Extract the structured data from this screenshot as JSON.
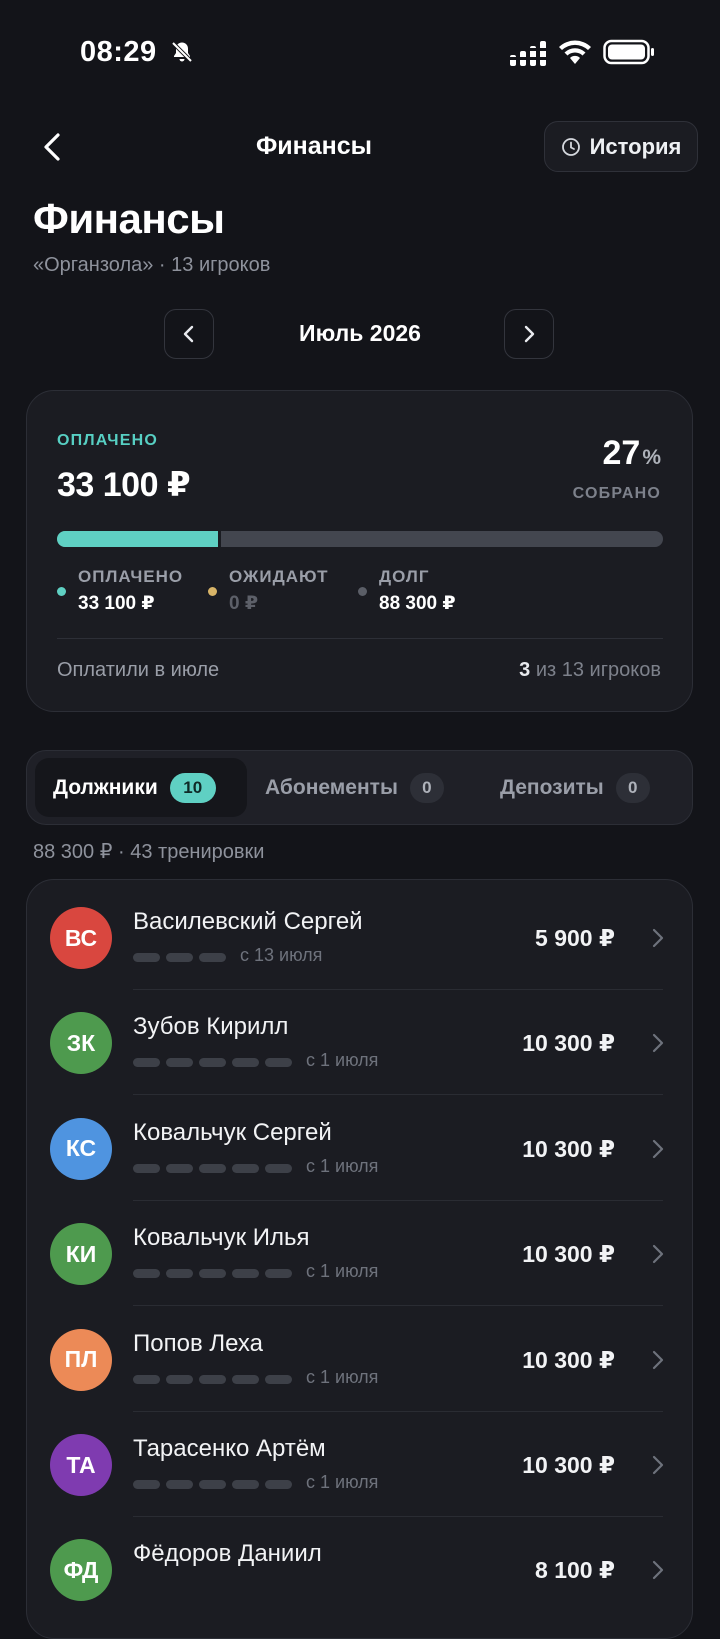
{
  "status_bar": {
    "time": "08:29"
  },
  "nav": {
    "title": "Финансы",
    "history_label": "История"
  },
  "header": {
    "title": "Финансы",
    "subtitle": "«Органзола» · 13 игроков"
  },
  "month": {
    "label": "Июль 2026"
  },
  "summary": {
    "paid_caption": "ОПЛАЧЕНО",
    "paid_amount": "33 100 ₽",
    "percent": "27",
    "percent_sign": "%",
    "collected_label": "СОБРАНО",
    "progress_fraction": 0.27,
    "legend": [
      {
        "label": "ОПЛАЧЕНО",
        "value": "33 100 ₽",
        "color": "#5fd0c3"
      },
      {
        "label": "ОЖИДАЮТ",
        "value": "0 ₽",
        "color": "#d8b468"
      },
      {
        "label": "ДОЛГ",
        "value": "88 300 ₽",
        "color": "#5b5e67"
      }
    ],
    "paid_in_month": "Оплатили в июле",
    "players_paid_count": "3",
    "players_paid_rest": " из 13 игроков"
  },
  "tabs": [
    {
      "label": "Должники",
      "count": "10",
      "active": true
    },
    {
      "label": "Абонементы",
      "count": "0",
      "active": false
    },
    {
      "label": "Депозиты",
      "count": "0",
      "active": false
    }
  ],
  "debt_summary": "88 300 ₽ · 43 тренировки",
  "debtors": [
    {
      "initials": "ВС",
      "name": "Василевский Сергей",
      "since": "с 13 июля",
      "amount": "5 900 ₽",
      "color": "#d9473f",
      "trainings": 3
    },
    {
      "initials": "ЗК",
      "name": "Зубов Кирилл",
      "since": "с 1 июля",
      "amount": "10 300 ₽",
      "color": "#4e9a4e",
      "trainings": 5
    },
    {
      "initials": "КС",
      "name": "Ковальчук Сергей",
      "since": "с 1 июля",
      "amount": "10 300 ₽",
      "color": "#4f94e0",
      "trainings": 5
    },
    {
      "initials": "КИ",
      "name": "Ковальчук Илья",
      "since": "с 1 июля",
      "amount": "10 300 ₽",
      "color": "#4e9a4e",
      "trainings": 5
    },
    {
      "initials": "ПЛ",
      "name": "Попов Леха",
      "since": "с 1 июля",
      "amount": "10 300 ₽",
      "color": "#ec8a57",
      "trainings": 5
    },
    {
      "initials": "ТА",
      "name": "Тарасенко Артём",
      "since": "с 1 июля",
      "amount": "10 300 ₽",
      "color": "#7f3bb0",
      "trainings": 5
    },
    {
      "initials": "ФД",
      "name": "Фёдоров Даниил",
      "since": "",
      "amount": "8 100 ₽",
      "color": "#4e9a4e",
      "trainings": 0
    }
  ]
}
